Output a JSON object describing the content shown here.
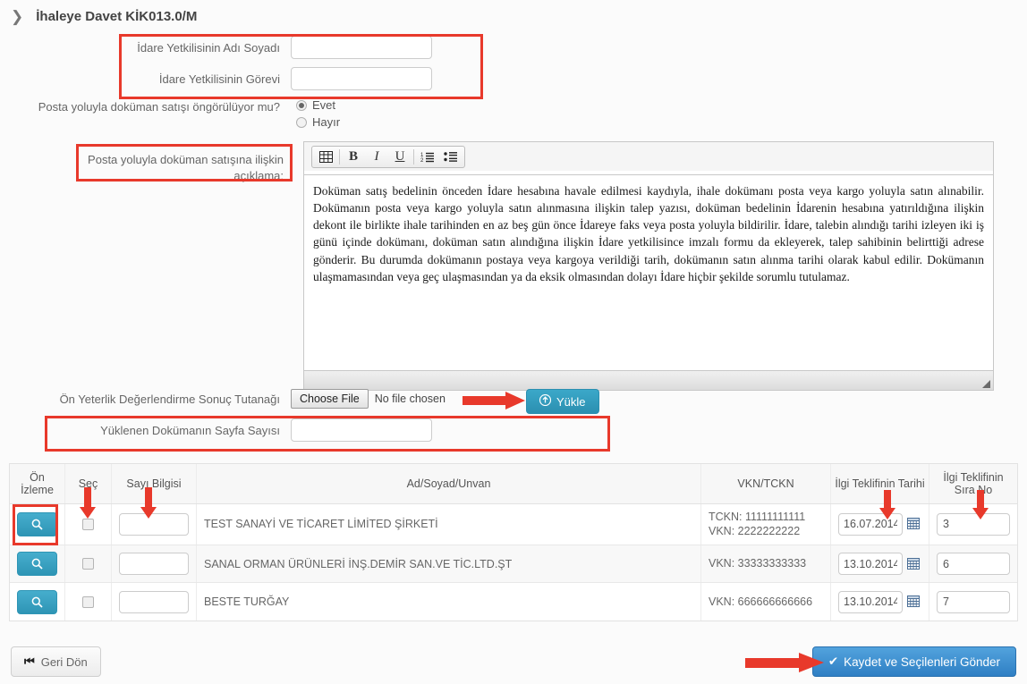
{
  "header": {
    "chevron_icon": "chevron-right-icon",
    "title": "İhaleye Davet KİK013.0/M"
  },
  "form": {
    "official_name_label": "İdare Yetkilisinin Adı Soyadı",
    "official_name_value": "",
    "official_role_label": "İdare Yetkilisinin Görevi",
    "official_role_value": "",
    "mail_sale_question": "Posta yoluyla doküman satışı öngörülüyor mu?",
    "radio_yes": "Evet",
    "radio_no": "Hayır",
    "radio_selected": "Evet",
    "explanation_label": "Posta yoluyla doküman satışına ilişkin açıklama:"
  },
  "editor": {
    "toolbar": [
      {
        "name": "table-icon",
        "glyph": "▦"
      },
      {
        "name": "bold-icon",
        "glyph": "B"
      },
      {
        "name": "italic-icon",
        "glyph": "I"
      },
      {
        "name": "underline-icon",
        "glyph": "U"
      },
      {
        "name": "ordered-list-icon",
        "glyph": "≔"
      },
      {
        "name": "unordered-list-icon",
        "glyph": "☰"
      }
    ],
    "body_text": "Doküman satış bedelinin önceden İdare hesabına havale edilmesi kaydıyla, ihale dokümanı posta veya kargo yoluyla satın alınabilir. Dokümanın posta veya kargo yoluyla satın alınmasına ilişkin talep yazısı, doküman bedelinin İdarenin hesabına yatırıldığına ilişkin dekont ile birlikte ihale tarihinden en az beş gün önce İdareye faks veya posta yoluyla bildirilir.  İdare, talebin alındığı tarihi izleyen iki iş günü içinde dokümanı, doküman satın alındığına ilişkin İdare yetkilisince imzalı formu da ekleyerek, talep sahibinin belirttiği adrese gönderir. Bu durumda dokümanın postaya veya kargoya verildiği tarih, dokümanın satın alınma tarihi olarak kabul edilir. Dokümanın ulaşmamasından veya geç ulaşmasından ya da eksik olmasından dolayı İdare hiçbir şekilde sorumlu tutulamaz.",
    "resize_grip_icon": "resize-grip-icon"
  },
  "upload": {
    "label": "Ön Yeterlik Değerlendirme Sonuç Tutanağı",
    "choose_file_label": "Choose File",
    "no_file_label": "No file chosen",
    "upload_button_label": "Yükle",
    "upload_icon": "upload-circle-icon",
    "pages_label": "Yüklenen Dokümanın Sayfa Sayısı",
    "pages_value": ""
  },
  "table": {
    "headers": [
      "Ön İzleme",
      "Seç",
      "Sayı Bilgisi",
      "Ad/Soyad/Unvan",
      "VKN/TCKN",
      "İlgi Teklifinin Tarihi",
      "İlgi Teklifinin Sıra No"
    ],
    "rows": [
      {
        "preview_icon": "search-icon",
        "selected": false,
        "sayi_bilgisi": "",
        "name": "TEST SANAYİ VE TİCARET LİMİTED ŞİRKETİ",
        "vkn_tckn_line1": "TCKN: 11111111111",
        "vkn_tckn_line2": "VKN: 2222222222",
        "date": "16.07.2014",
        "calendar_icon": "calendar-icon",
        "sira_no": "3"
      },
      {
        "preview_icon": "search-icon",
        "selected": false,
        "sayi_bilgisi": "",
        "name": "SANAL ORMAN ÜRÜNLERİ İNŞ.DEMİR SAN.VE TİC.LTD.ŞT",
        "vkn_tckn_line1": "VKN: 33333333333",
        "vkn_tckn_line2": "",
        "date": "13.10.2014",
        "calendar_icon": "calendar-icon",
        "sira_no": "6"
      },
      {
        "preview_icon": "search-icon",
        "selected": false,
        "sayi_bilgisi": "",
        "name": "BESTE TURĞAY",
        "vkn_tckn_line1": "VKN: 666666666666",
        "vkn_tckn_line2": "",
        "date": "13.10.2014",
        "calendar_icon": "calendar-icon",
        "sira_no": "7"
      }
    ]
  },
  "footer": {
    "back_label": "Geri Dön",
    "back_icon": "step-backward-icon",
    "submit_label": "Kaydet ve Seçilenleri Gönder",
    "submit_icon": "check-icon"
  },
  "colors": {
    "annotation_red": "#e8392b",
    "teal_button": "#2e95b5",
    "blue_button": "#2f7fc4"
  }
}
